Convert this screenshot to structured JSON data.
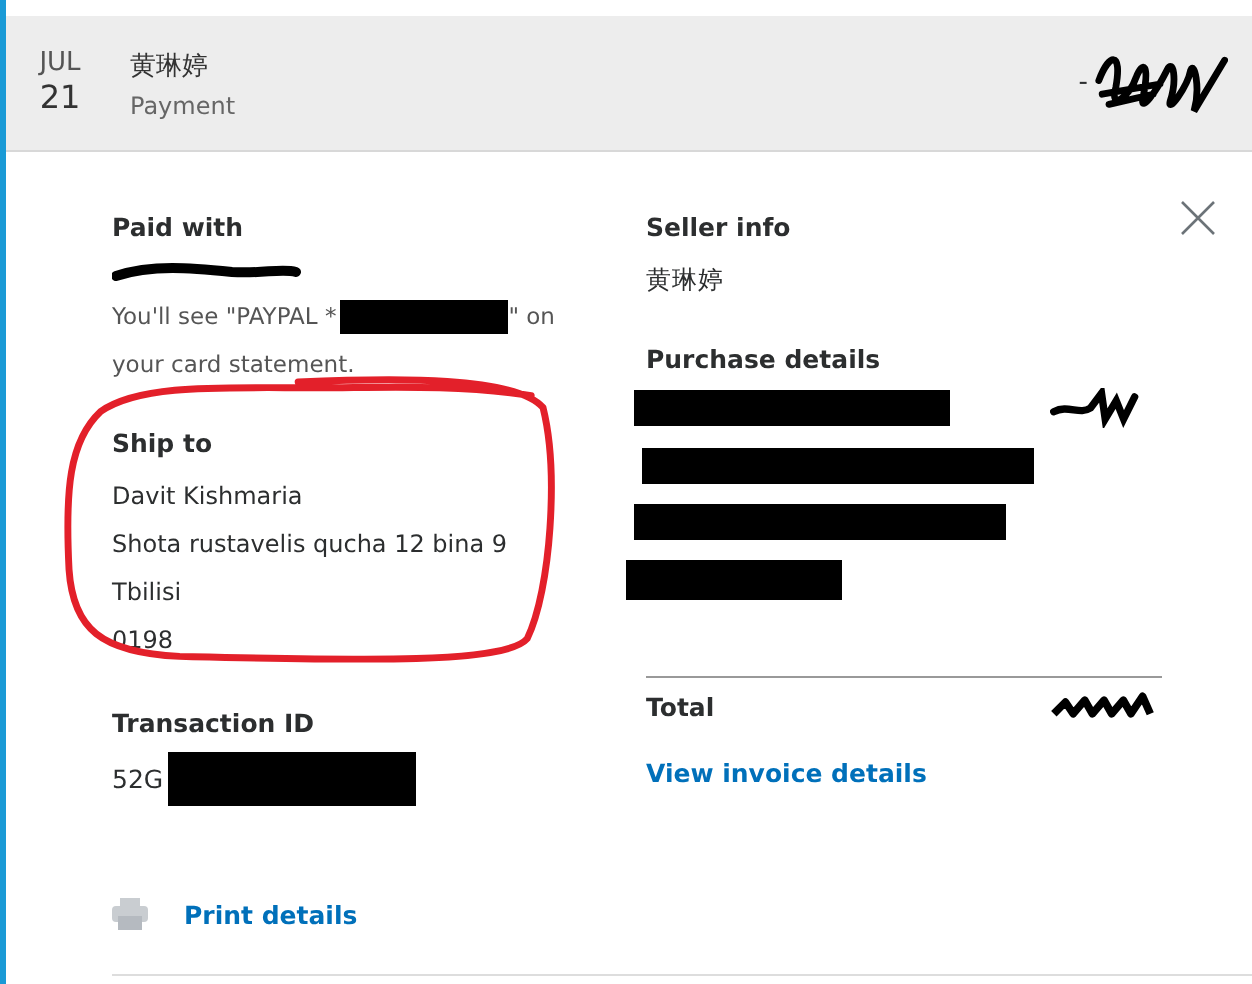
{
  "header": {
    "month": "JUL",
    "day": "21",
    "name": "黄琳婷",
    "type": "Payment",
    "amount_sign": "-"
  },
  "paid_with": {
    "heading": "Paid with",
    "note_before": "You'll see \"PAYPAL *",
    "note_after": "\" on",
    "note_line2": "your card statement."
  },
  "ship_to": {
    "heading": "Ship to",
    "lines": [
      "Davit Kishmaria",
      "Shota rustavelis qucha 12 bina 9",
      "Tbilisi",
      "0198"
    ]
  },
  "transaction": {
    "heading": "Transaction ID",
    "id_visible": "52G"
  },
  "print": {
    "label": "Print details"
  },
  "seller": {
    "heading": "Seller info",
    "name": "黄琳婷"
  },
  "purchase": {
    "heading": "Purchase details"
  },
  "total": {
    "label": "Total"
  },
  "invoice_link": {
    "label": "View invoice details"
  }
}
